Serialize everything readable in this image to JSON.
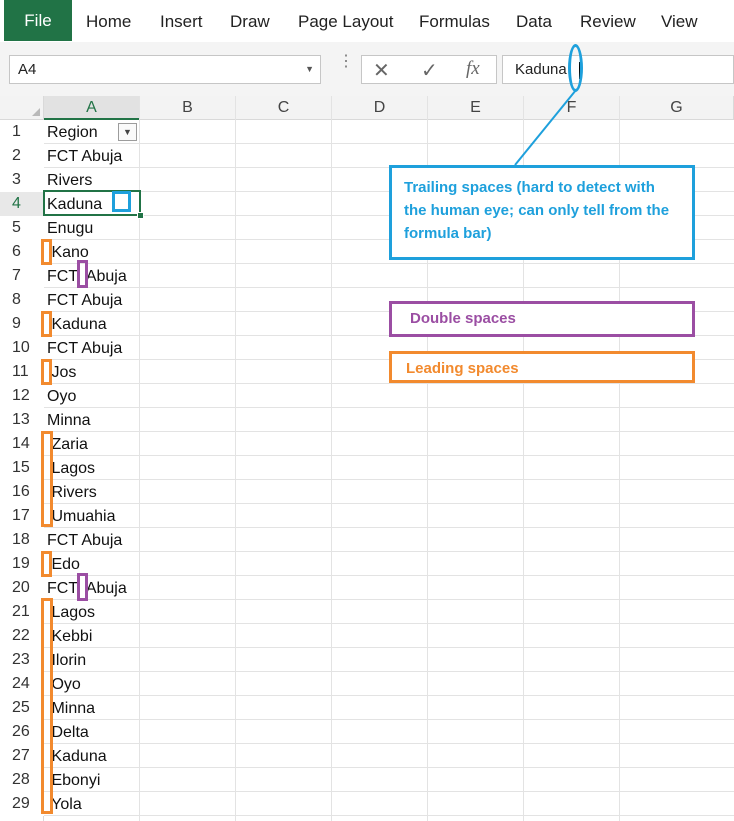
{
  "ribbon": {
    "file_label": "File",
    "tabs": [
      "Home",
      "Insert",
      "Draw",
      "Page Layout",
      "Formulas",
      "Data",
      "Review",
      "View"
    ],
    "accent_color": "#217346"
  },
  "formula_bar": {
    "name_box": "A4",
    "formula_value": "Kaduna",
    "cancel_icon": "close-icon",
    "enter_icon": "check-icon",
    "function_icon": "fx-icon"
  },
  "sheet": {
    "columns": [
      "A",
      "B",
      "C",
      "D",
      "E",
      "F",
      "G"
    ],
    "selected_column": "A",
    "selected_row": 4,
    "rows": [
      {
        "num": "1",
        "a": "Region"
      },
      {
        "num": "2",
        "a": "FCT Abuja"
      },
      {
        "num": "3",
        "a": "Rivers"
      },
      {
        "num": "4",
        "a": "Kaduna"
      },
      {
        "num": "5",
        "a": "Enugu"
      },
      {
        "num": "6",
        "a": " Kano"
      },
      {
        "num": "7",
        "a": "FCT  Abuja"
      },
      {
        "num": "8",
        "a": "FCT Abuja"
      },
      {
        "num": "9",
        "a": " Kaduna"
      },
      {
        "num": "10",
        "a": "FCT Abuja"
      },
      {
        "num": "11",
        "a": " Jos"
      },
      {
        "num": "12",
        "a": "Oyo"
      },
      {
        "num": "13",
        "a": "Minna"
      },
      {
        "num": "14",
        "a": " Zaria"
      },
      {
        "num": "15",
        "a": " Lagos"
      },
      {
        "num": "16",
        "a": " Rivers"
      },
      {
        "num": "17",
        "a": " Umuahia"
      },
      {
        "num": "18",
        "a": "FCT Abuja"
      },
      {
        "num": "19",
        "a": " Edo"
      },
      {
        "num": "20",
        "a": "FCT  Abuja"
      },
      {
        "num": "21",
        "a": " Lagos"
      },
      {
        "num": "22",
        "a": " Kebbi"
      },
      {
        "num": "23",
        "a": " Ilorin"
      },
      {
        "num": "24",
        "a": " Oyo"
      },
      {
        "num": "25",
        "a": " Minna"
      },
      {
        "num": "26",
        "a": " Delta"
      },
      {
        "num": "27",
        "a": " Kaduna"
      },
      {
        "num": "28",
        "a": " Ebonyi"
      },
      {
        "num": "29",
        "a": " Yola"
      }
    ]
  },
  "annotations": {
    "trailing_note": "Trailing spaces (hard to detect with the human eye; can only tell from the formula bar)",
    "double_note": "Double spaces",
    "leading_note": "Leading spaces",
    "colors": {
      "trailing": "#1ea0dc",
      "double": "#9b4ea3",
      "leading": "#f28a2e"
    }
  }
}
